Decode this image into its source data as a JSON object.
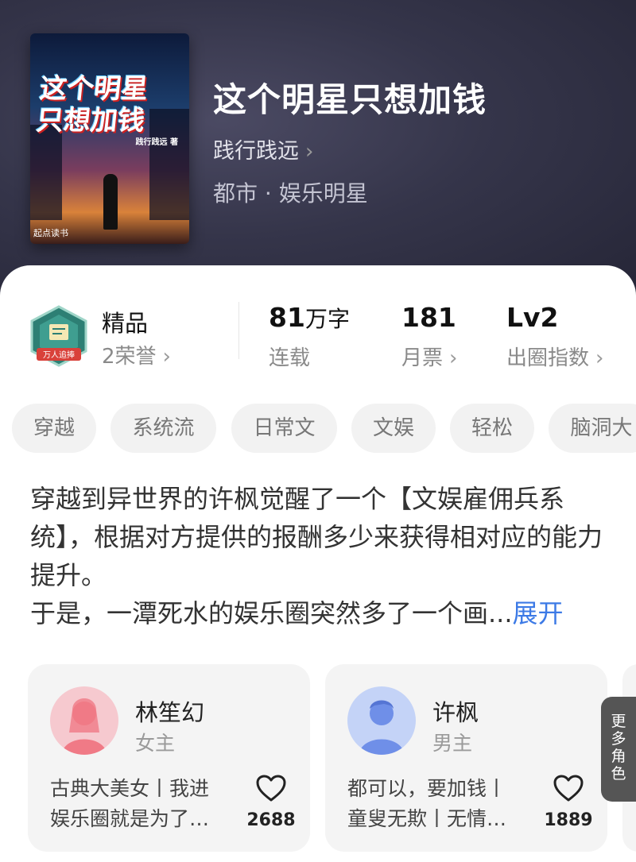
{
  "book": {
    "title": "这个明星只想加钱",
    "author": "践行践远",
    "genre": "都市 · 娱乐明星",
    "cover": {
      "title_line1": "这个明星",
      "title_line2": "只想加钱",
      "author_mark": "践行践远 著",
      "publisher": "起点读书"
    }
  },
  "stats": {
    "badge_label": "万人追捧",
    "quality": "精品",
    "honor": "2荣誉",
    "words_value": "81",
    "words_unit": "万字",
    "words_status": "连载",
    "monthly_value": "181",
    "monthly_label": "月票",
    "index_value": "Lv2",
    "index_label": "出圈指数"
  },
  "tags": [
    "穿越",
    "系统流",
    "日常文",
    "文娱",
    "轻松",
    "脑洞大"
  ],
  "description": {
    "line1": "穿越到异世界的许枫觉醒了一个【文娱雇佣兵系统】，根据对方提供的报酬多少来获得相对应的能力提升。",
    "line2": "于是，一潭死水的娱乐圈突然多了一个画...",
    "expand": "展开"
  },
  "characters": [
    {
      "name": "林笙幻",
      "role": "女主",
      "desc_line1": "古典大美女丨我进",
      "desc_line2": "娱乐圈就是为了…",
      "likes": "2688",
      "avatar_color": "#f07a86"
    },
    {
      "name": "许枫",
      "role": "男主",
      "desc_line1": "都可以，要加钱丨",
      "desc_line2": "童叟无欺丨无情…",
      "likes": "1889",
      "avatar_color": "#6f8fe8"
    }
  ],
  "more_roles": [
    "更",
    "多",
    "角",
    "色"
  ]
}
